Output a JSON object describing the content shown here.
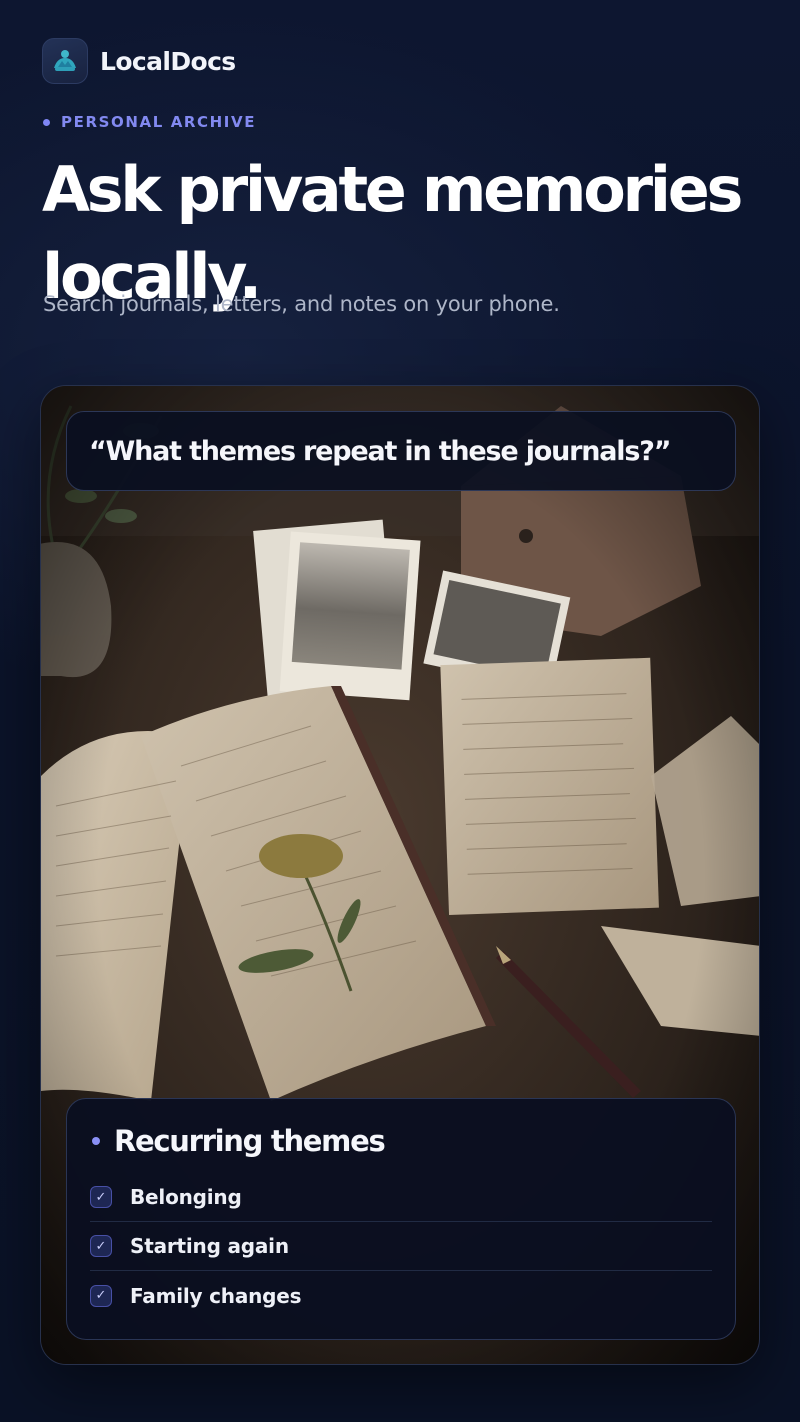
{
  "app": {
    "name": "LocalDocs",
    "logo_icon": "teal-turtle-icon"
  },
  "hero": {
    "eyebrow": "PERSONAL ARCHIVE",
    "headline_line1": "Ask private memories",
    "headline_line2": "locally.",
    "subtitle": "Search journals, letters, and notes on your phone."
  },
  "card": {
    "query": "“What themes repeat in these journals?”",
    "themes_title": "Recurring themes",
    "themes": [
      {
        "label": "Belonging",
        "checked": true
      },
      {
        "label": "Starting again",
        "checked": true
      },
      {
        "label": "Family changes",
        "checked": true
      }
    ],
    "check_glyph": "✓"
  },
  "colors": {
    "background": "#0c1428",
    "accent": "#8289f0",
    "panel": "#0a0f20",
    "text": "#ffffff"
  }
}
